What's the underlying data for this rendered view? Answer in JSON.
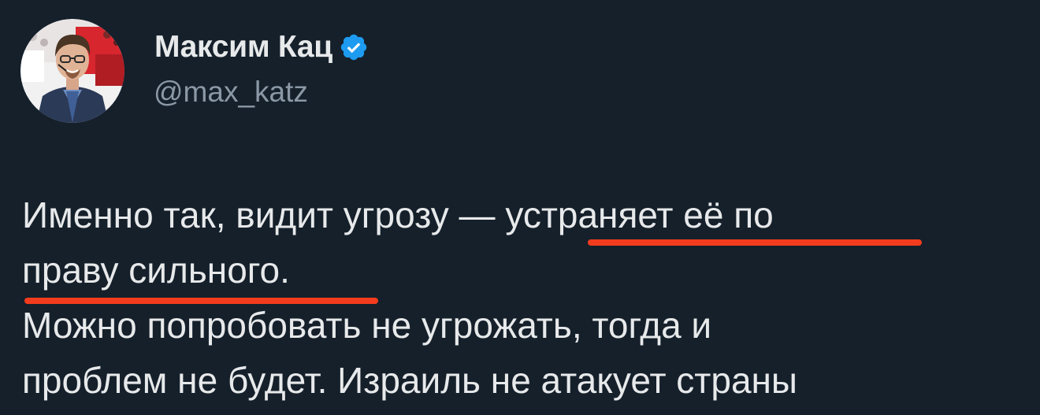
{
  "author": {
    "display_name": "Максим Кац",
    "handle": "@max_katz",
    "verified": true,
    "verified_color": "#1d9bf0"
  },
  "tweet": {
    "lines": [
      "Именно так, видит угрозу — устраняет её по",
      "праву сильного.",
      "Можно попробовать не угрожать, тогда и",
      "проблем не будет. Израиль не атакует страны"
    ],
    "highlights_color": "#f33c1d"
  },
  "colors": {
    "background": "#15202b",
    "text": "#e7e9ea",
    "secondary_text": "#8b98a5"
  }
}
